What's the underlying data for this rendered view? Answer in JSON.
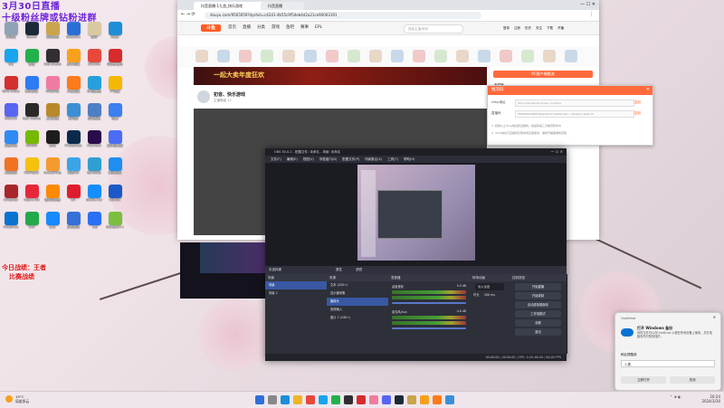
{
  "overlay": {
    "title_line1": "3月30日直播",
    "title_line2": "十级粉丝牌或钻粉进群",
    "red_line1": "今日战绩：王者",
    "red_line2": "比赛战绩"
  },
  "desktop_icons": [
    {
      "label": "回收站",
      "color": "#8fa3b6"
    },
    {
      "label": "Steam",
      "color": "#1b2838"
    },
    {
      "label": "英雄联盟",
      "color": "#c9a44c"
    },
    {
      "label": "WeGame",
      "color": "#2a6fd8"
    },
    {
      "label": "原神",
      "color": "#d9c9a0"
    },
    {
      "label": "Edge",
      "color": "#1c8fd8"
    },
    {
      "label": "QQ",
      "color": "#18a5ee"
    },
    {
      "label": "微信",
      "color": "#22b14c"
    },
    {
      "label": "OBS Studio",
      "color": "#302e31"
    },
    {
      "label": "虎牙直播",
      "color": "#f9a11b"
    },
    {
      "label": "Chrome",
      "color": "#e7483b"
    },
    {
      "label": "网易云音乐",
      "color": "#d82b2b"
    },
    {
      "label": "WPS Office",
      "color": "#d52f2f"
    },
    {
      "label": "腾讯会议",
      "color": "#2e7bf6"
    },
    {
      "label": "哔哩哔哩",
      "color": "#f07ba1"
    },
    {
      "label": "斗鱼直播",
      "color": "#ff7a1a"
    },
    {
      "label": "UU加速器",
      "color": "#26a0da"
    },
    {
      "label": "YY语音",
      "color": "#f5b800"
    },
    {
      "label": "Discord",
      "color": "#5865f2"
    },
    {
      "label": "Epic Games",
      "color": "#2a2a2a"
    },
    {
      "label": "王者荣耀",
      "color": "#b8892b"
    },
    {
      "label": "此电脑",
      "color": "#3b8fd6"
    },
    {
      "label": "控制面板",
      "color": "#4e7fc4"
    },
    {
      "label": "迅雷",
      "color": "#3c7ff0"
    },
    {
      "label": "百度网盘",
      "color": "#2f8af5"
    },
    {
      "label": "NVIDIA",
      "color": "#76b900"
    },
    {
      "label": "剪映",
      "color": "#1d1d1d"
    },
    {
      "label": "Photoshop",
      "color": "#0b2a4b"
    },
    {
      "label": "Premiere",
      "color": "#2a0b4b"
    },
    {
      "label": "雷神加速器",
      "color": "#4a6cf7"
    },
    {
      "label": "火绒安全",
      "color": "#f07322"
    },
    {
      "label": "PotPlayer",
      "color": "#f4c20d"
    },
    {
      "label": "Everything",
      "color": "#f39b2f"
    },
    {
      "label": "网易UU",
      "color": "#3aa4e8"
    },
    {
      "label": "Bandizip",
      "color": "#2f9fd0"
    },
    {
      "label": "腾讯视频",
      "color": "#1f8ef1"
    },
    {
      "label": "CCleaner",
      "color": "#a8262b"
    },
    {
      "label": "Opera GX",
      "color": "#e8263a"
    },
    {
      "label": "猎豹浏览器",
      "color": "#ff8a00"
    },
    {
      "label": "EA",
      "color": "#e01d2c"
    },
    {
      "label": "Battle.net",
      "color": "#148eff"
    },
    {
      "label": "Ubisoft",
      "color": "#1b59c7"
    },
    {
      "label": "OneDrive",
      "color": "#0a72d0"
    },
    {
      "label": "360",
      "color": "#22a94a"
    },
    {
      "label": "钉钉",
      "color": "#1689ff"
    },
    {
      "label": "企业微信",
      "color": "#3471d8"
    },
    {
      "label": "飞书",
      "color": "#2a70f5"
    },
    {
      "label": "Notepad++",
      "color": "#7bbf3d"
    }
  ],
  "browser": {
    "tab1": "抖音直播-1九游_快乐游戏",
    "tab2": "抖音直播",
    "url": "douyu.com/9565059?dyshid=c4241-4b55c9f54eb4d2a21ce90003191",
    "logo": "斗鱼",
    "nav": [
      "首页",
      "直播",
      "分类",
      "游戏",
      "鱼吧",
      "赛事",
      "EPL"
    ],
    "search_placeholder": "搜索主播/房间",
    "top_right": [
      "登录",
      "注册",
      "历史",
      "关注",
      "下载",
      "开播"
    ],
    "banner_text": "一起大卖年度狂欢",
    "room_title": "初音、快乐游戏",
    "room_meta": "主播等级 12",
    "side_title": "PC客户端推流",
    "side_items": [
      "贵宾榜",
      "粉丝榜",
      "连麦申请",
      "VIP- Sukill",
      "钻粉 大佬"
    ]
  },
  "push_dialog": {
    "title": "推流码",
    "url_label": "rtmp地址",
    "url_value": "rtmp://sendtc3a.douyu.com/live",
    "key_label": "直播码",
    "key_value": "9565059rKMHDSkqCfgYtc?wsSecret=...&token=web-h5",
    "copy": "复制",
    "note1": "1. 复制以上rtmp地址和直播码，粘贴到第三方推流软件中",
    "note2": "2. rtmp地址与直播码仅限本场直播使用，重新开播需重新获取"
  },
  "obs": {
    "title": "OBS 30.0.2 - 配置文件: 未命名 - 场景: 未命名",
    "menu": [
      "文件(F)",
      "编辑(E)",
      "视图(V)",
      "停靠窗口(D)",
      "配置文件(P)",
      "场景集合(S)",
      "工具(T)",
      "帮助(H)"
    ],
    "no_source": "未选择源",
    "props": "属性",
    "filters": "滤镜",
    "scenes_header": "场景",
    "scenes": [
      "场景",
      "场景 2"
    ],
    "sources_header": "来源",
    "sources": [
      "文本 (GDI+)",
      "显示器采集",
      "摄像头",
      "音频输入",
      "图片 2 (GDI+)"
    ],
    "mixer_header": "混音器",
    "mixer_channels": [
      {
        "name": "桌面音频",
        "db": "0.0 dB"
      },
      {
        "name": "麦克风/Aux",
        "db": "-4.6 dB"
      }
    ],
    "transition_header": "转场动画",
    "transition_value": "淡入淡出",
    "duration_label": "时长",
    "duration_value": "300 ms",
    "controls_header": "控制按钮",
    "controls": [
      "开始直播",
      "开始录制",
      "启动虚拟摄像机",
      "工作室模式",
      "设置",
      "退出"
    ],
    "status": "00:00:00  |  00:00:00  |  CPU: 0.4%  60.00 / 60.00 FPS"
  },
  "toast": {
    "app": "OneDrive",
    "title": "打开 Windows 备份",
    "body": "你的文件可以在OneDrive 以便在所有设备上使用，并在电脑丢失时受到保护。",
    "remind": "稍后提醒我",
    "select_value": "1 周",
    "primary": "立即打开",
    "secondary": "关闭"
  },
  "taskbar": {
    "weather_temp": "19°C",
    "weather_desc": "局部多云",
    "time": "16:24",
    "date": "2024/3/30"
  }
}
